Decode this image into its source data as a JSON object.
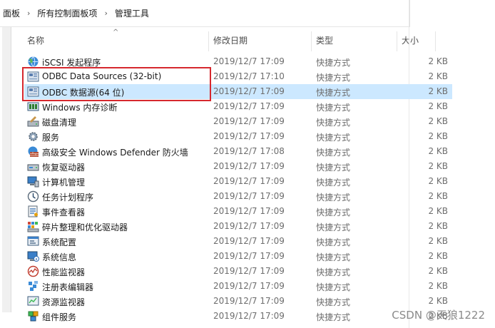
{
  "address_bar": {
    "crumbs": [
      "面板",
      "所有控制面板项",
      "管理工具"
    ]
  },
  "columns": {
    "name": "名称",
    "date": "修改日期",
    "type": "类型",
    "size": "大小"
  },
  "rows": [
    {
      "name": "iSCSI 发起程序",
      "date": "2019/12/7 17:09",
      "type": "快捷方式",
      "size": "2 KB",
      "icon": "iscsi-globe-icon",
      "selected": false
    },
    {
      "name": "ODBC Data Sources (32-bit)",
      "date": "2019/12/7 17:10",
      "type": "快捷方式",
      "size": "2 KB",
      "icon": "odbc-icon",
      "selected": false
    },
    {
      "name": "ODBC 数据源(64 位)",
      "date": "2019/12/7 17:09",
      "type": "快捷方式",
      "size": "2 KB",
      "icon": "odbc-icon",
      "selected": true
    },
    {
      "name": "Windows 内存诊断",
      "date": "2019/12/7 17:09",
      "type": "快捷方式",
      "size": "2 KB",
      "icon": "memory-diagnostic-icon",
      "selected": false
    },
    {
      "name": "磁盘清理",
      "date": "2019/12/7 17:09",
      "type": "快捷方式",
      "size": "2 KB",
      "icon": "disk-cleanup-icon",
      "selected": false
    },
    {
      "name": "服务",
      "date": "2019/12/7 17:09",
      "type": "快捷方式",
      "size": "2 KB",
      "icon": "services-gear-icon",
      "selected": false
    },
    {
      "name": "高级安全 Windows Defender 防火墙",
      "date": "2019/12/7 17:08",
      "type": "快捷方式",
      "size": "2 KB",
      "icon": "firewall-icon",
      "selected": false
    },
    {
      "name": "恢复驱动器",
      "date": "2019/12/7 17:09",
      "type": "快捷方式",
      "size": "2 KB",
      "icon": "recovery-drive-icon",
      "selected": false
    },
    {
      "name": "计算机管理",
      "date": "2019/12/7 17:09",
      "type": "快捷方式",
      "size": "2 KB",
      "icon": "computer-management-icon",
      "selected": false
    },
    {
      "name": "任务计划程序",
      "date": "2019/12/7 17:09",
      "type": "快捷方式",
      "size": "2 KB",
      "icon": "task-scheduler-icon",
      "selected": false
    },
    {
      "name": "事件查看器",
      "date": "2019/12/7 17:09",
      "type": "快捷方式",
      "size": "2 KB",
      "icon": "event-viewer-icon",
      "selected": false
    },
    {
      "name": "碎片整理和优化驱动器",
      "date": "2019/12/7 17:09",
      "type": "快捷方式",
      "size": "2 KB",
      "icon": "defrag-icon",
      "selected": false
    },
    {
      "name": "系统配置",
      "date": "2019/12/7 17:09",
      "type": "快捷方式",
      "size": "2 KB",
      "icon": "system-config-icon",
      "selected": false
    },
    {
      "name": "系统信息",
      "date": "2019/12/7 17:09",
      "type": "快捷方式",
      "size": "2 KB",
      "icon": "system-info-icon",
      "selected": false
    },
    {
      "name": "性能监视器",
      "date": "2019/12/7 17:09",
      "type": "快捷方式",
      "size": "2 KB",
      "icon": "performance-monitor-icon",
      "selected": false
    },
    {
      "name": "注册表编辑器",
      "date": "2019/12/7 17:09",
      "type": "快捷方式",
      "size": "2 KB",
      "icon": "registry-editor-icon",
      "selected": false
    },
    {
      "name": "资源监视器",
      "date": "2019/12/7 17:09",
      "type": "快捷方式",
      "size": "2 KB",
      "icon": "resource-monitor-icon",
      "selected": false
    },
    {
      "name": "组件服务",
      "date": "2019/12/7 17:09",
      "type": "快捷方式",
      "size": "2 KB",
      "icon": "component-services-icon",
      "selected": false
    }
  ],
  "watermark": "CSDN @天狼1222",
  "colors": {
    "selection": "#cce8ff",
    "highlight_border": "#d6282e"
  }
}
